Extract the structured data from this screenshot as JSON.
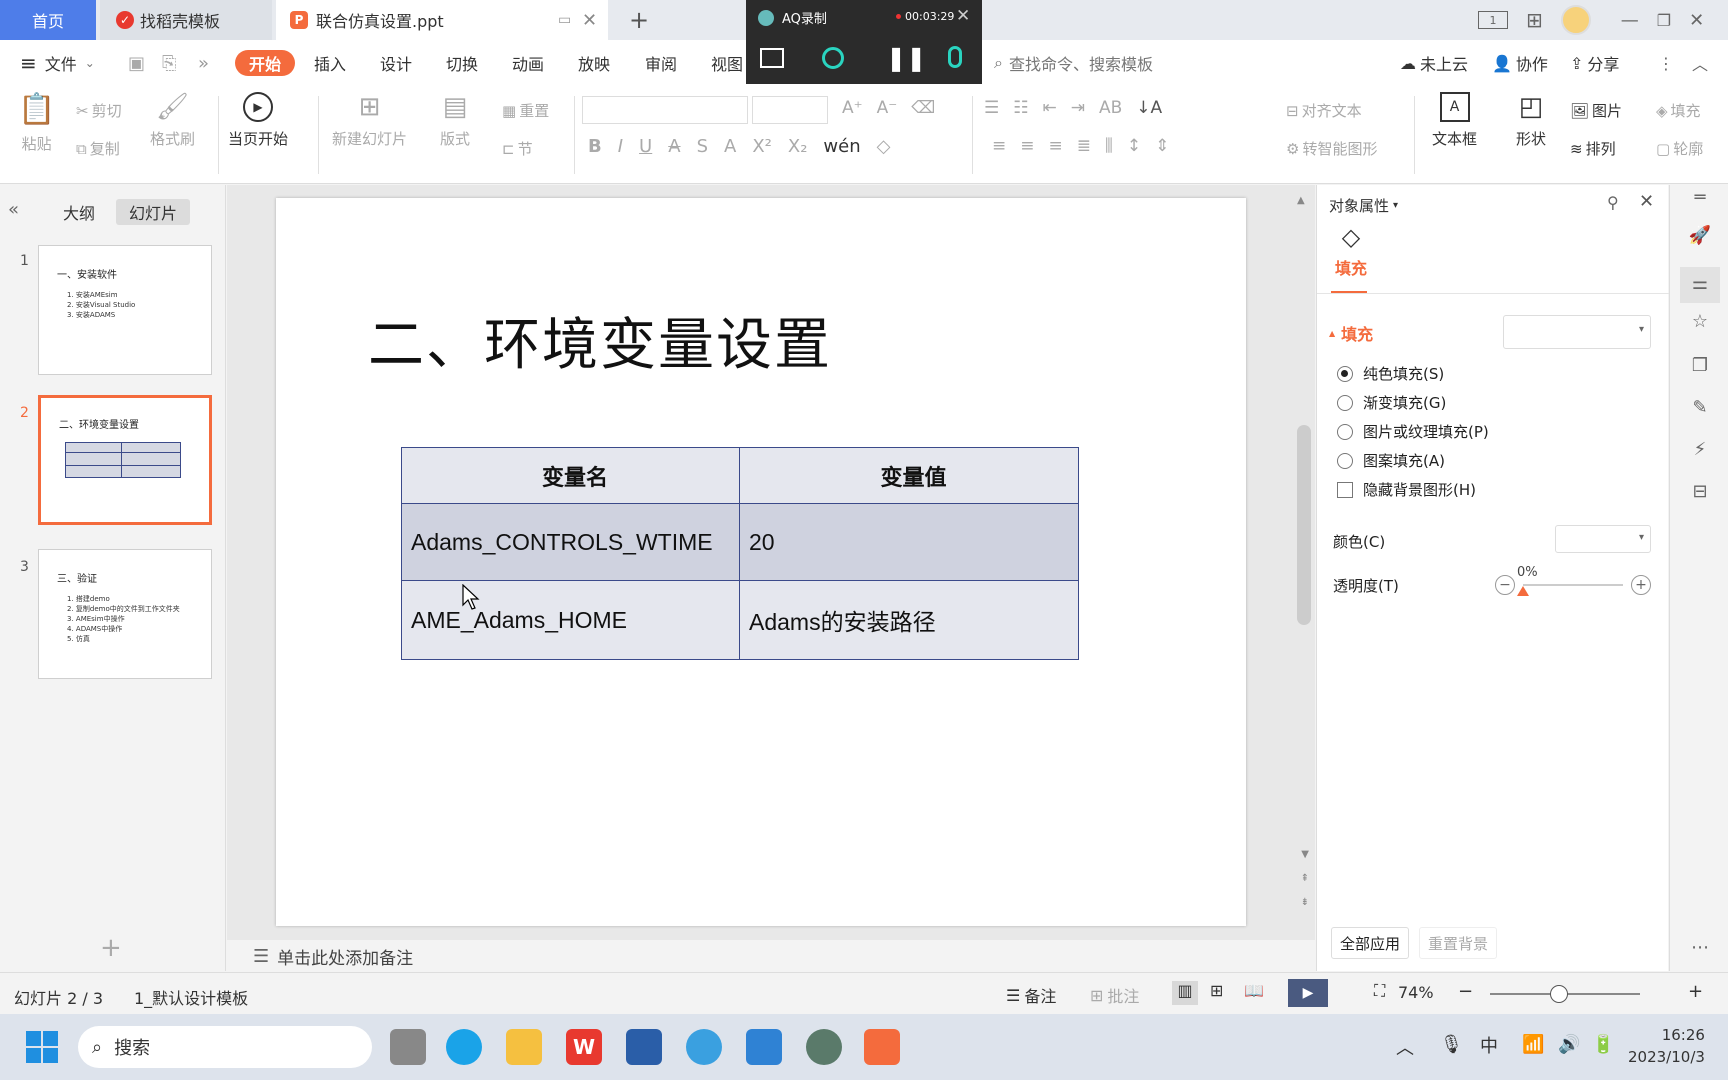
{
  "tabs": {
    "home": "首页",
    "docer": "找稻壳模板",
    "doc": "联合仿真设置.ppt",
    "new_tab": "+"
  },
  "recorder": {
    "title": "AQ录制",
    "time": "00:03:29"
  },
  "menu": {
    "file": "文件",
    "items": [
      "开始",
      "插入",
      "设计",
      "切换",
      "动画",
      "放映",
      "审阅",
      "视图"
    ],
    "search_placeholder": "查找命令、搜索模板",
    "cloud": "未上云",
    "collab": "协作",
    "share": "分享"
  },
  "ribbon": {
    "paste": "粘贴",
    "cut": "剪切",
    "copy": "复制",
    "format_painter": "格式刷",
    "play_from_current": "当页开始",
    "new_slide": "新建幻灯片",
    "layout": "版式",
    "reset": "重置",
    "section": "节",
    "align_text": "对齐文本",
    "convert_smartart": "转智能图形",
    "textbox": "文本框",
    "shape": "形状",
    "picture": "图片",
    "arrange": "排列",
    "fill": "填充",
    "outline": "轮廓"
  },
  "left_pane": {
    "outline_tab": "大纲",
    "slides_tab": "幻灯片",
    "thumbs": [
      {
        "num": "1",
        "title": "一、安装软件",
        "lines": [
          "1. 安装AMEsim",
          "2. 安装Visual Studio",
          "3. 安装ADAMS"
        ]
      },
      {
        "num": "2",
        "title": "二、环境变量设置",
        "lines": []
      },
      {
        "num": "3",
        "title": "三、验证",
        "lines": [
          "1. 搭建demo",
          "2. 复制demo中的文件到工作文件夹",
          "3. AMEsim中操作",
          "4. ADAMS中操作",
          "5. 仿真"
        ]
      }
    ]
  },
  "slide": {
    "title": "二、环境变量设置",
    "table": {
      "headers": [
        "变量名",
        "变量值"
      ],
      "rows": [
        [
          "Adams_CONTROLS_WTIME",
          "20"
        ],
        [
          "AME_Adams_HOME",
          "Adams的安装路径"
        ]
      ]
    }
  },
  "notes_placeholder": "单击此处添加备注",
  "right_panel": {
    "title": "对象属性",
    "tab": "填充",
    "section": "填充",
    "options": [
      "纯色填充(S)",
      "渐变填充(G)",
      "图片或纹理填充(P)",
      "图案填充(A)"
    ],
    "checkbox": "隐藏背景图形(H)",
    "color_label": "颜色(C)",
    "transparency_label": "透明度(T)",
    "transparency_value": "0%",
    "transparency_level": 0,
    "apply_all": "全部应用",
    "reset_bg": "重置背景"
  },
  "status": {
    "slide_info": "幻灯片 2 / 3",
    "template": "1_默认设计模板",
    "notes": "备注",
    "comments": "批注",
    "zoom": "74%"
  },
  "taskbar": {
    "search": "搜索",
    "time": "16:26",
    "date": "2023/10/3",
    "ime": "中"
  }
}
